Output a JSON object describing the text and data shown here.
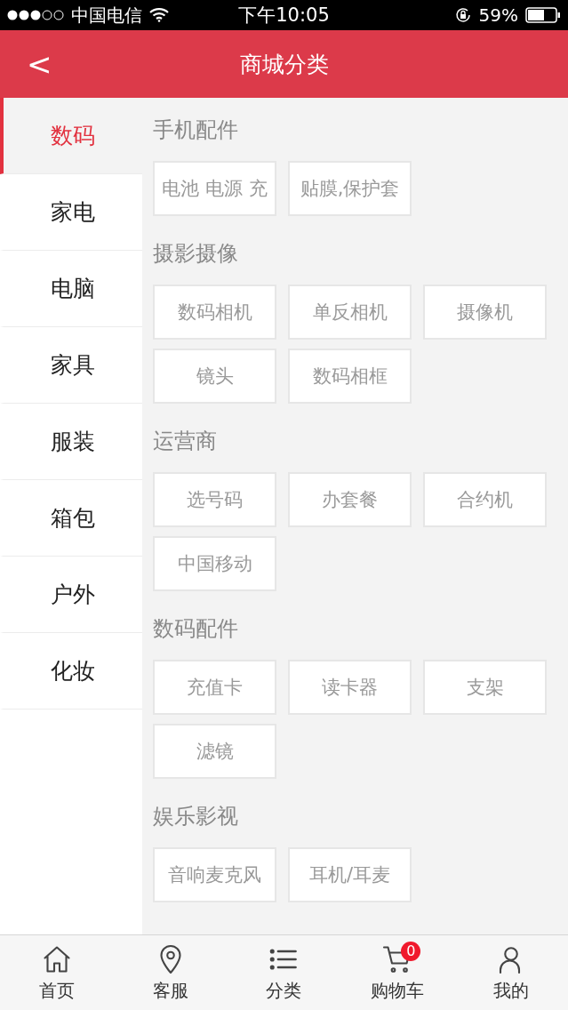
{
  "status_bar": {
    "carrier": "中国电信",
    "time": "下午10:05",
    "battery": "59%"
  },
  "header": {
    "back": "<",
    "title": "商城分类"
  },
  "sidebar": {
    "items": [
      {
        "label": "数码",
        "selected": true
      },
      {
        "label": "家电",
        "selected": false
      },
      {
        "label": "电脑",
        "selected": false
      },
      {
        "label": "家具",
        "selected": false
      },
      {
        "label": "服装",
        "selected": false
      },
      {
        "label": "箱包",
        "selected": false
      },
      {
        "label": "户外",
        "selected": false
      },
      {
        "label": "化妆",
        "selected": false
      }
    ]
  },
  "sections": [
    {
      "title": "手机配件",
      "items": [
        "电池 电源 充",
        "贴膜,保护套"
      ]
    },
    {
      "title": "摄影摄像",
      "items": [
        "数码相机",
        "单反相机",
        "摄像机",
        "镜头",
        "数码相框"
      ]
    },
    {
      "title": "运营商",
      "items": [
        "选号码",
        "办套餐",
        "合约机",
        "中国移动"
      ]
    },
    {
      "title": "数码配件",
      "items": [
        "充值卡",
        "读卡器",
        "支架",
        "滤镜"
      ]
    },
    {
      "title": "娱乐影视",
      "items": [
        "音响麦克风",
        "耳机/耳麦"
      ]
    }
  ],
  "tab_bar": [
    {
      "kind": "home",
      "label": "首页"
    },
    {
      "kind": "location",
      "label": "客服"
    },
    {
      "kind": "list",
      "label": "分类"
    },
    {
      "kind": "cart",
      "label": "购物车",
      "badge": "0"
    },
    {
      "kind": "user",
      "label": "我的"
    }
  ]
}
